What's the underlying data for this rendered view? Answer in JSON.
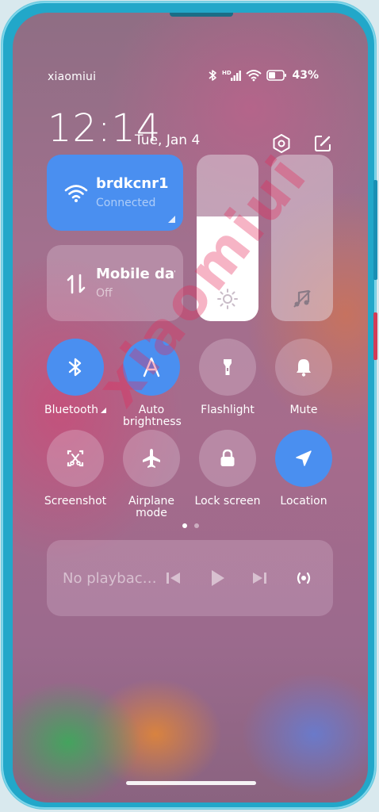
{
  "status_bar": {
    "carrier": "xiaomiui",
    "battery": "43%",
    "network_badge": "HD"
  },
  "header": {
    "time": "12:14",
    "date": "Tue, Jan 4"
  },
  "tiles": {
    "wifi": {
      "title": "brdkcnr1",
      "subtitle": "Connected",
      "active": true
    },
    "mobile_data": {
      "title": "Mobile data",
      "subtitle": "Off",
      "active": false
    }
  },
  "sliders": {
    "brightness": {
      "level": 0.63,
      "icon": "brightness-icon"
    },
    "volume": {
      "level": 0.0,
      "icon": "music-note-icon"
    }
  },
  "toggles": [
    {
      "label": "Bluetooth",
      "icon": "bluetooth-icon",
      "active": true,
      "has_more": true
    },
    {
      "label": "Auto brightness",
      "icon": "auto-brightness-icon",
      "active": true
    },
    {
      "label": "Flashlight",
      "icon": "flashlight-icon",
      "active": false
    },
    {
      "label": "Mute",
      "icon": "bell-icon",
      "active": false
    },
    {
      "label": "Screenshot",
      "icon": "screenshot-icon",
      "active": false
    },
    {
      "label": "Airplane mode",
      "icon": "airplane-icon",
      "active": false
    },
    {
      "label": "Lock screen",
      "icon": "lock-icon",
      "active": false
    },
    {
      "label": "Location",
      "icon": "location-icon",
      "active": true
    }
  ],
  "page_indicator": {
    "current": 1,
    "total": 2
  },
  "media": {
    "title": "No playbac…"
  },
  "watermark": "xiaomiui",
  "colors": {
    "accent": "#4a8ff0",
    "frame": "#22a7c9"
  }
}
